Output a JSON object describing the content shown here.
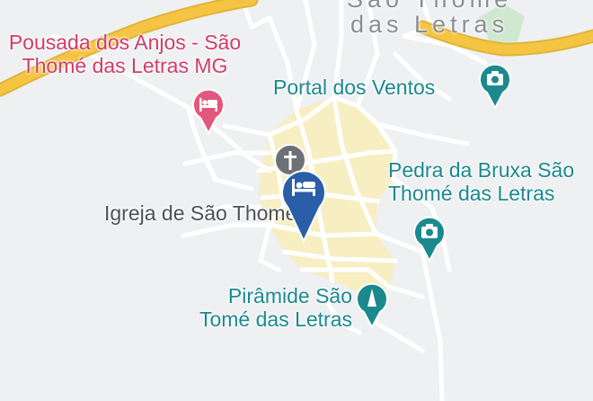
{
  "colors": {
    "background": "#eef0f2",
    "road": "#ffffff",
    "highway": "#f5c542",
    "center_area": "#f7eec2",
    "park": "#cfe8cf",
    "attraction": "#1b8a8f",
    "lodging": "#d13c69",
    "selected_lodging": "#2a5ea8",
    "religious": "#5f6368"
  },
  "town_label": {
    "line1": "São Thomé",
    "line2": "das Letras"
  },
  "places": [
    {
      "name_line1": "Portal dos Ventos",
      "name_line2": "",
      "category": "attraction",
      "icon": "camera-icon"
    },
    {
      "name_line1": "Pedra da Bruxa São",
      "name_line2": "Thomé das Letras",
      "category": "attraction",
      "icon": "camera-icon"
    },
    {
      "name_line1": "Pirâmide São",
      "name_line2": "Tomé das Letras",
      "category": "attraction",
      "icon": "monument-icon"
    },
    {
      "name_line1": "Pousada dos Anjos - São",
      "name_line2": "Thomé das Letras MG",
      "category": "lodging",
      "icon": "bed-icon"
    },
    {
      "name_line1": "Igreja de São Thomé",
      "name_line2": "",
      "category": "religious",
      "icon": "cross-icon"
    }
  ],
  "selected_marker": {
    "icon": "bed-icon",
    "category": "selected_lodging"
  }
}
